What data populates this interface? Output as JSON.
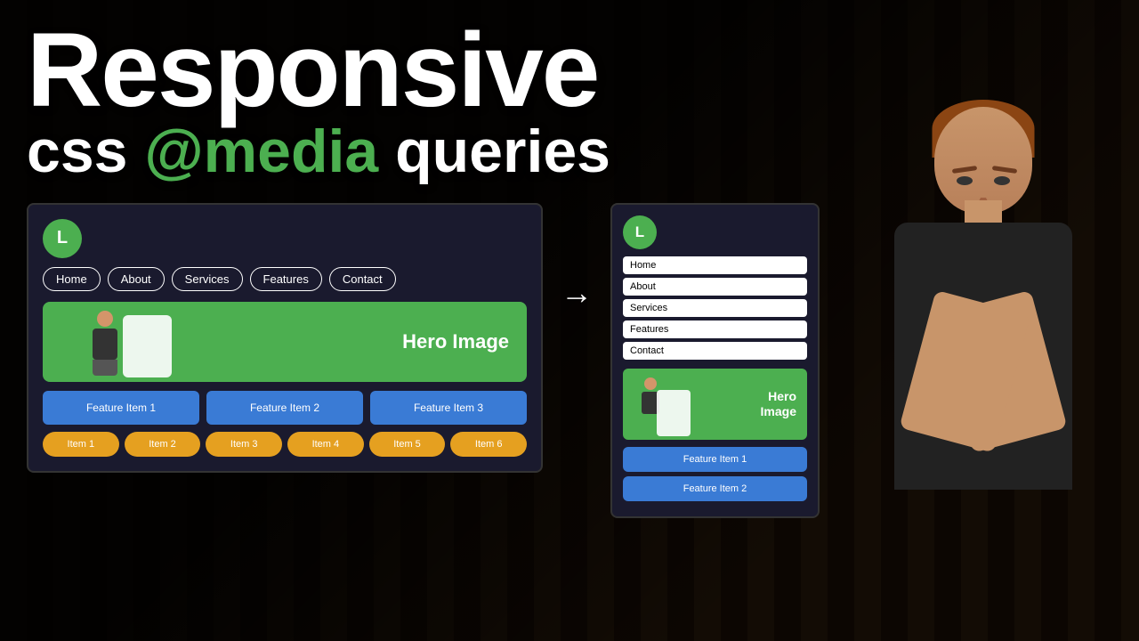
{
  "title": {
    "main": "Responsive",
    "sub_prefix": "css ",
    "sub_highlight": "@media",
    "sub_suffix": " queries"
  },
  "desktop_mock": {
    "logo_letter": "L",
    "nav_items": [
      "Home",
      "About",
      "Services",
      "Features",
      "Contact"
    ],
    "hero_text": "Hero Image",
    "features": [
      "Feature Item 1",
      "Feature Item 2",
      "Feature Item 3"
    ],
    "items": [
      "Item 1",
      "Item 2",
      "Item 3",
      "Item 4",
      "Item 5",
      "Item 6"
    ]
  },
  "mobile_mock": {
    "logo_letter": "L",
    "nav_items": [
      "Home",
      "About",
      "Services",
      "Features",
      "Contact"
    ],
    "hero_text_line1": "Hero",
    "hero_text_line2": "Image",
    "features": [
      "Feature Item 1",
      "Feature Item 2"
    ]
  },
  "arrow": "→",
  "colors": {
    "green": "#4caf50",
    "blue": "#3a7bd5",
    "orange": "#e5a020",
    "dark_bg": "#1a1a2e"
  }
}
